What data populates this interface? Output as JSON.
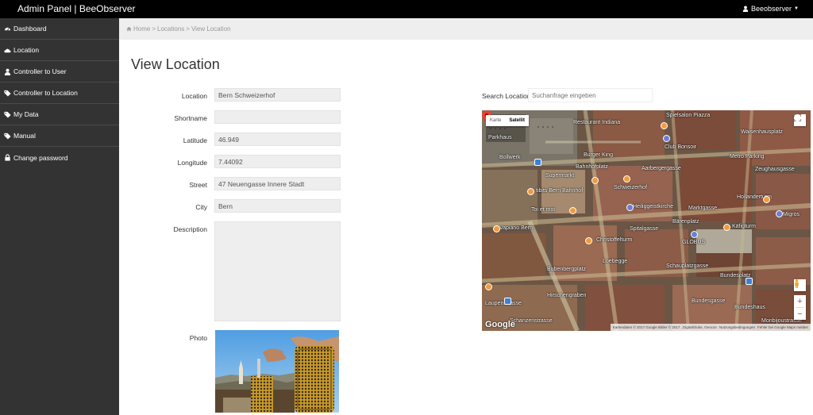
{
  "app": {
    "title": "Admin Panel | BeeObserver"
  },
  "user": {
    "name": "Beeobserver"
  },
  "sidebar": {
    "items": [
      {
        "label": "Dashboard",
        "icon": "dashboard-icon"
      },
      {
        "label": "Location",
        "icon": "cloud-icon"
      },
      {
        "label": "Controller to User",
        "icon": "user-icon"
      },
      {
        "label": "Controller to Location",
        "icon": "tag-icon"
      },
      {
        "label": "My Data",
        "icon": "tag-icon"
      },
      {
        "label": "Manual",
        "icon": "tag-icon"
      },
      {
        "label": "Change password",
        "icon": "lock-icon"
      }
    ]
  },
  "breadcrumb": {
    "home": "Home",
    "sep1": ">",
    "locations": "Locations",
    "sep2": ">",
    "current": "View Location"
  },
  "page": {
    "title": "View Location"
  },
  "form": {
    "location": {
      "label": "Location",
      "value": "Bern Schweizerhof"
    },
    "shortname": {
      "label": "Shortname",
      "value": ""
    },
    "latitude": {
      "label": "Latitude",
      "value": "46.949"
    },
    "longitude": {
      "label": "Longitude",
      "value": "7.44092"
    },
    "street": {
      "label": "Street",
      "value": "47 Neuengasse Innere Stadt"
    },
    "city": {
      "label": "City",
      "value": "Bern"
    },
    "description": {
      "label": "Description",
      "value": ""
    },
    "photo": {
      "label": "Photo"
    }
  },
  "search": {
    "label": "Search Location",
    "placeholder": "Suchanfrage eingeben"
  },
  "map": {
    "type_map": "Karte",
    "type_satellite": "Satellit",
    "zoom_in": "+",
    "zoom_out": "−",
    "logo": "Google",
    "footer_data": "Kartendaten © 2017 Google Bilder © 2017 , DigitalGlobe, Geocon",
    "footer_terms": "Nutzungsbedingungen",
    "footer_report": "Fehler bei Google Maps melden",
    "labels": {
      "restaurant_indiana": "Restaurant Indiana",
      "parkhaus": "Parkhaus",
      "burger_king": "Burger King",
      "supermarkt": "Supermarkt",
      "schweizerhof": "Schweizerhof",
      "bibits": "tibits Bern Bahnhof",
      "toi_et_moi": "Toi et moi",
      "heiliggeistkirche": "Heiliggeistkirche",
      "vapiano": "Vapiano Bern",
      "christoffelturm": "Christoffelturm",
      "loebegge": "Loebegge",
      "bubenbergplatz": "Bubenbergplatz",
      "spielsalon": "Spielsalon Piazza",
      "club_bonsoir": "Club Bonsoir",
      "waisenhausplatz": "Waisenhausplatz",
      "metro_parking": "Metro Parking",
      "hollanderturm": "Hollanderturm",
      "migros": "Migros",
      "barenplatz": "Bärenplatz",
      "kafigturm": "Käfigturm",
      "globus": "GLOBUS",
      "schauplatzgasse": "Schauplatzgasse",
      "bundesplatz": "Bundesplatz",
      "bundesgasse": "Bundesgasse",
      "bundeshaus": "Bundeshaus",
      "schanzenstrasse": "Schanzenstrasse",
      "bahnhofplatz": "Bahnhofplatz",
      "spitalgasse": "Spitalgasse",
      "marktgasse": "Marktgasse",
      "zeughausgasse": "Zeughausgasse",
      "aarbergergasse": "Aarbergergasse",
      "bollwerk": "Bollwerk",
      "laupenstrasse": "Laupenstrasse",
      "hirschengraben": "Hirschengraben",
      "monbijoustrasse": "Monbijoustrasse"
    }
  }
}
